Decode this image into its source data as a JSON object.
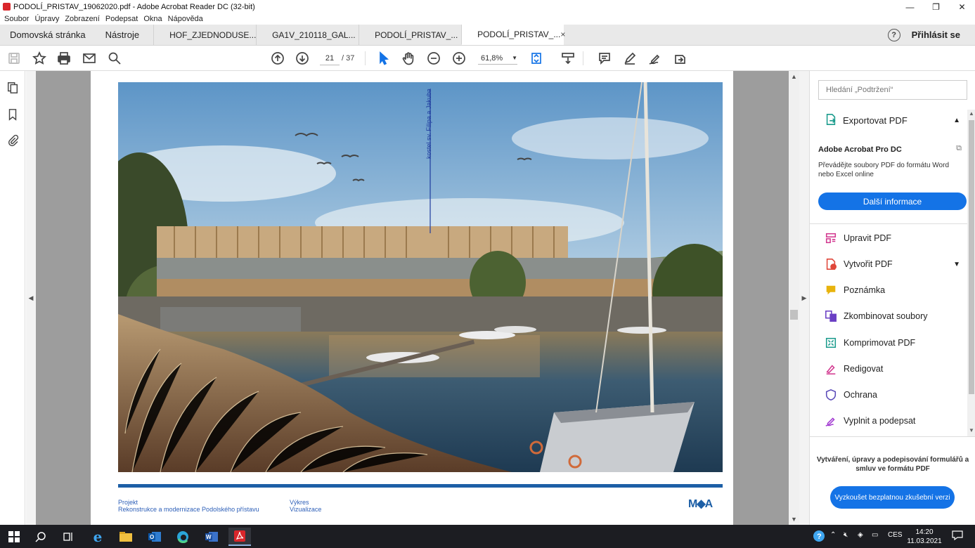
{
  "window": {
    "title": "PODOLÍ_PRISTAV_19062020.pdf - Adobe Acrobat Reader DC (32-bit)",
    "minimize": "—",
    "maximize": "❐",
    "close": "✕"
  },
  "menu": [
    "Soubor",
    "Úpravy",
    "Zobrazení",
    "Podepsat",
    "Okna",
    "Nápověda"
  ],
  "tabs": {
    "home": "Domovská stránka",
    "tools": "Nástroje",
    "documents": [
      {
        "label": "HOF_ZJEDNODUSE...",
        "active": false
      },
      {
        "label": "GA1V_210118_GAL...",
        "active": false
      },
      {
        "label": "PODOLÍ_PRISTAV_...",
        "active": false
      },
      {
        "label": "PODOLÍ_PRISTAV_...",
        "active": true
      }
    ],
    "close_glyph": "×",
    "help": "?",
    "sign_in": "Přihlásit se"
  },
  "toolbar": {
    "current_page": "21",
    "page_count": "/ 37",
    "zoom": "61,8%",
    "icons": [
      "save-icon",
      "bookmark-star-icon",
      "print-icon",
      "email-icon",
      "search-icon",
      "page-up-icon",
      "page-down-icon",
      "select-cursor-icon",
      "hand-icon",
      "zoom-out-icon",
      "zoom-in-icon",
      "fit-page-icon",
      "scroll-mode-icon",
      "comment-icon",
      "highlight-pen-icon",
      "sign-icon",
      "share-icon"
    ]
  },
  "left_rail": [
    "pages-icon",
    "bookmarks-icon",
    "attachments-icon"
  ],
  "document": {
    "image_label": "kostel sv. Filipa a Jakuba",
    "footer": {
      "project_label": "Projekt",
      "project_value": "Rekonstrukce a modernizace Podolského přístavu",
      "drawing_label": "Výkres",
      "drawing_value": "Vizualizace",
      "logo": "M◆A"
    }
  },
  "right_panel": {
    "search_placeholder": "Hledání „Podtržení“",
    "export": "Exportovat PDF",
    "promo_title": "Adobe Acrobat Pro DC",
    "promo_text": "Převádějte soubory PDF do formátu Word nebo Excel online",
    "promo_button": "Další informace",
    "tools": [
      {
        "label": "Upravit PDF",
        "icon": "edit-pdf-icon",
        "color": "#d2378f",
        "chevron": false
      },
      {
        "label": "Vytvořit PDF",
        "icon": "create-pdf-icon",
        "color": "#e0473a",
        "chevron": true
      },
      {
        "label": "Poznámka",
        "icon": "comment-note-icon",
        "color": "#e8b30c",
        "chevron": false
      },
      {
        "label": "Zkombinovat soubory",
        "icon": "combine-files-icon",
        "color": "#6a3fc4",
        "chevron": false
      },
      {
        "label": "Komprimovat PDF",
        "icon": "compress-pdf-icon",
        "color": "#1a9b8c",
        "chevron": false
      },
      {
        "label": "Redigovat",
        "icon": "redact-icon",
        "color": "#d2378f",
        "chevron": false
      },
      {
        "label": "Ochrana",
        "icon": "protect-shield-icon",
        "color": "#5a4ab8",
        "chevron": false
      },
      {
        "label": "Vyplnit a podepsat",
        "icon": "fill-sign-icon",
        "color": "#a23ad1",
        "chevron": false
      }
    ],
    "bottom_text": "Vytváření, úpravy a podepisování formulářů a smluv ve formátu PDF",
    "trial_button": "Vyzkoušet bezplatnou zkušební verzi"
  },
  "taskbar": {
    "apps": [
      "start-icon",
      "search-icon",
      "task-view-icon",
      "internet-explorer-icon",
      "file-explorer-icon",
      "outlook-icon",
      "edge-icon",
      "word-icon",
      "acrobat-icon"
    ],
    "language": "CES",
    "time": "14:20",
    "date": "11.03.2021"
  },
  "colors": {
    "accent": "#1473e6",
    "tab_bg": "#e9e9e9",
    "viewer_bg": "#9d9d9d",
    "doc_blue": "#1d5fa6"
  }
}
